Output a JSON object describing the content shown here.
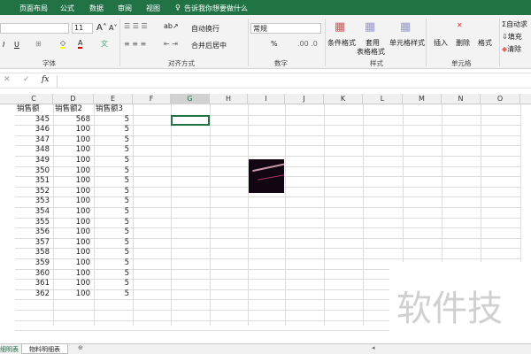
{
  "tabs": [
    "页面布局",
    "公式",
    "数据",
    "审阅",
    "视图"
  ],
  "tell_me": "告诉我你想要做什么",
  "ribbon": {
    "font_size": "11",
    "bold": "I",
    "underline": "U",
    "wrap": "自动换行",
    "merge": "合并后居中",
    "number_format": "常规",
    "percent": "%",
    "cond_format": "条件格式",
    "table_format_1": "套用",
    "table_format_2": "表格格式",
    "cell_style": "单元格样式",
    "insert": "插入",
    "delete": "删除",
    "format": "格式",
    "autosum": "自动求",
    "fill": "填充",
    "clear": "清除",
    "groups": {
      "font": "字体",
      "align": "对齐方式",
      "number": "数字",
      "styles": "样式",
      "cells": "单元格"
    }
  },
  "formula_bar": {
    "fx": "fx",
    "value": ""
  },
  "columns": [
    "C",
    "D",
    "E",
    "F",
    "G",
    "H",
    "I",
    "J",
    "K",
    "L",
    "M",
    "N",
    "O"
  ],
  "headers": [
    "销售额",
    "销售额2",
    "销售额3"
  ],
  "rows": [
    [
      345,
      568,
      5
    ],
    [
      346,
      100,
      5
    ],
    [
      347,
      100,
      5
    ],
    [
      348,
      100,
      5
    ],
    [
      349,
      100,
      5
    ],
    [
      350,
      100,
      5
    ],
    [
      351,
      100,
      5
    ],
    [
      352,
      100,
      5
    ],
    [
      353,
      100,
      5
    ],
    [
      354,
      100,
      5
    ],
    [
      355,
      100,
      5
    ],
    [
      356,
      100,
      5
    ],
    [
      357,
      100,
      5
    ],
    [
      358,
      100,
      5
    ],
    [
      359,
      100,
      5
    ],
    [
      360,
      100,
      5
    ],
    [
      361,
      100,
      5
    ],
    [
      362,
      100,
      5
    ]
  ],
  "sheets": [
    "细明表",
    "物料明细表"
  ],
  "watermark": "软件技"
}
